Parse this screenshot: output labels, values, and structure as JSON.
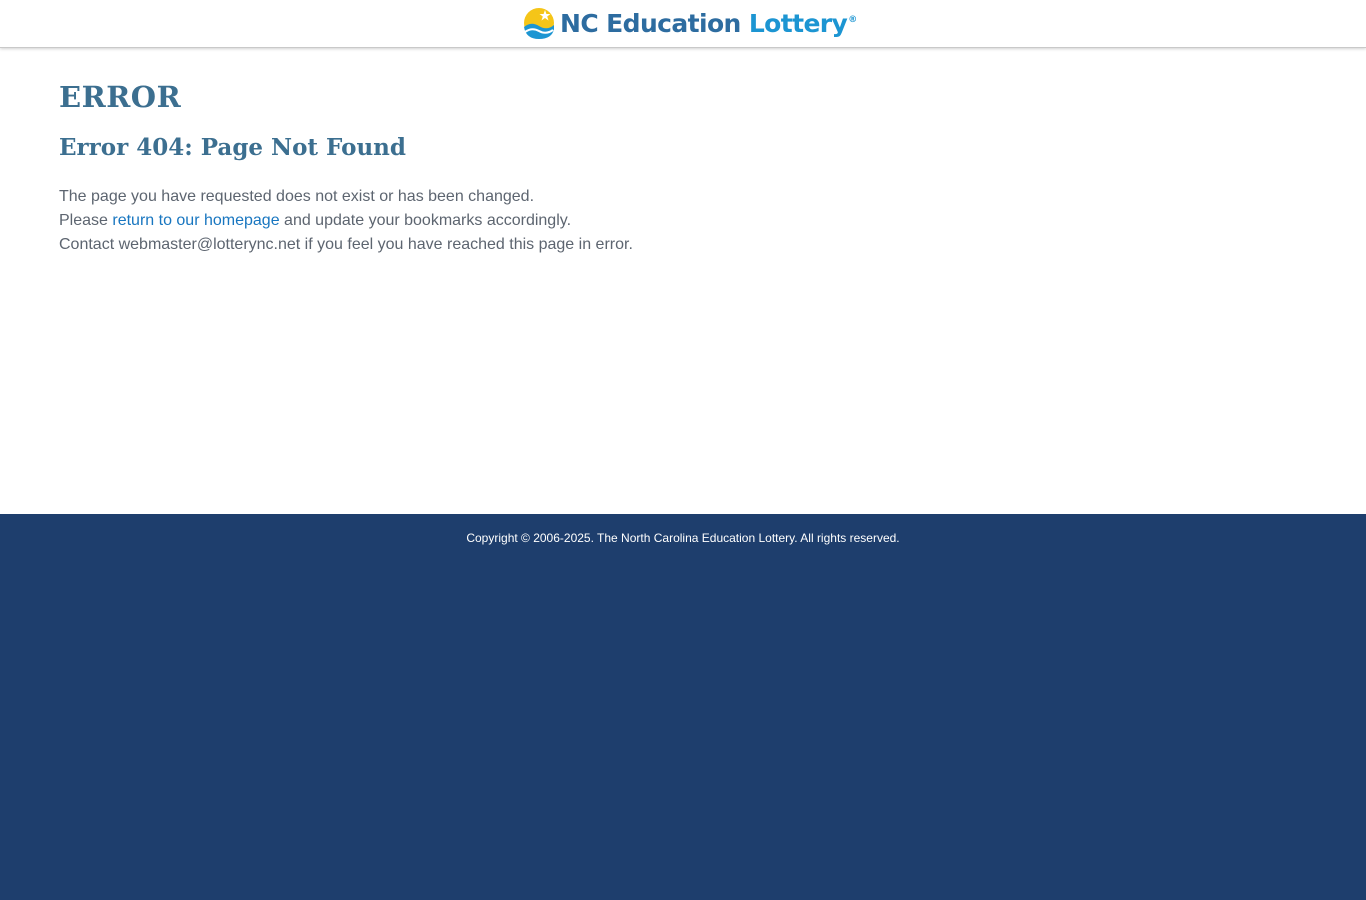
{
  "header": {
    "logo": {
      "name_part1": "NC Education",
      "name_part2": "Lottery",
      "trademark": "®",
      "icon": "sun-wave-logo-icon"
    }
  },
  "main": {
    "title": "ERROR",
    "subtitle": "Error 404: Page Not Found",
    "line1": "The page you have requested does not exist or has been changed.",
    "line2_prefix": "Please ",
    "line2_link": "return to our homepage",
    "line2_suffix": " and update your bookmarks accordingly.",
    "line3": "Contact webmaster@lotterync.net if you feel you have reached this page in error."
  },
  "footer": {
    "copyright": "Copyright © 2006-2025. The North Carolina Education Lottery. All rights reserved."
  },
  "colors": {
    "heading": "#3c6f90",
    "link": "#1876c0",
    "footer_bg": "#1e3e6d",
    "logo_nc": "#2d6ca0",
    "logo_lottery": "#1c95d2",
    "logo_sun": "#f5c518"
  }
}
